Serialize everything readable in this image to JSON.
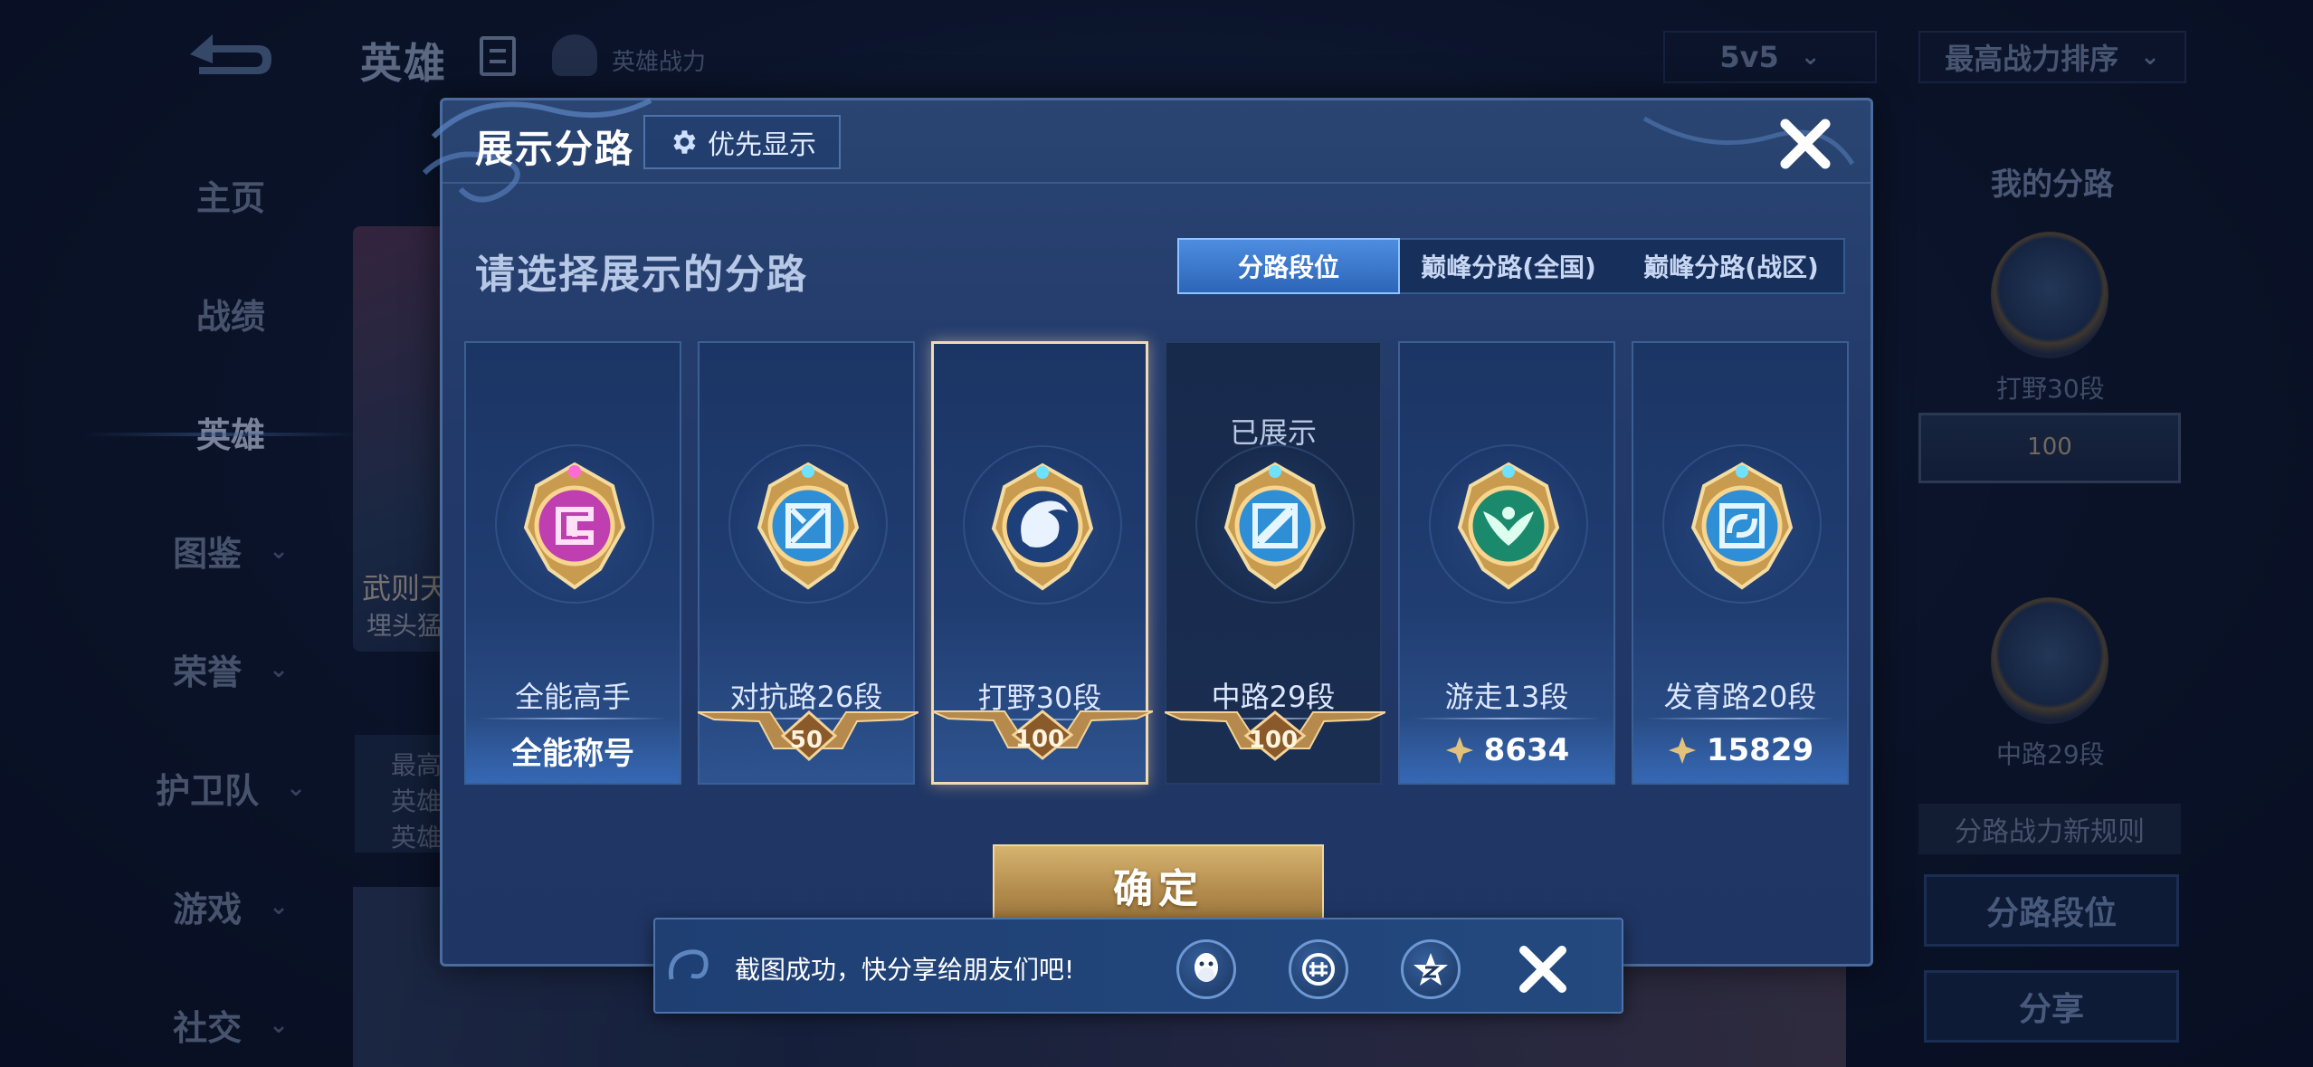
{
  "background": {
    "top_title": "英雄",
    "top_sub": "英雄战力",
    "mode_dropdown": "5v5",
    "sort_dropdown": "最高战力排序",
    "nav": [
      {
        "label": "主页",
        "has_chevron": false
      },
      {
        "label": "战绩",
        "has_chevron": false
      },
      {
        "label": "英雄",
        "has_chevron": false,
        "active": true
      },
      {
        "label": "图鉴",
        "has_chevron": true
      },
      {
        "label": "荣誉",
        "has_chevron": true
      },
      {
        "label": "护卫队",
        "has_chevron": true
      },
      {
        "label": "游戏",
        "has_chevron": true
      },
      {
        "label": "社交",
        "has_chevron": true
      }
    ],
    "hero_name": "武则天",
    "hero_sub": "埋头猛",
    "hero_info": [
      "最高",
      "英雄",
      "英雄"
    ],
    "right_panel": {
      "title": "我的分路",
      "badge1_label": "打野30段",
      "badge1_plate": "100",
      "badge2_label": "中路29段",
      "rule": "分路战力新规则",
      "btn_lane": "分路段位",
      "btn_share": "分享"
    }
  },
  "modal": {
    "title": "展示分路",
    "priority_button": "优先显示",
    "subtitle": "请选择展示的分路",
    "tabs": [
      {
        "label": "分路段位",
        "active": true
      },
      {
        "label": "巅峰分路(全国)",
        "active": false
      },
      {
        "label": "巅峰分路(战区)",
        "active": false
      }
    ],
    "cards": [
      {
        "name": "全能高手",
        "footer_type": "text",
        "footer": "全能称号",
        "emblem": "allround-emblem-icon",
        "accent": "#c03fb0"
      },
      {
        "name": "对抗路26段",
        "footer_type": "plate",
        "footer": "50",
        "emblem": "clash-lane-emblem-icon",
        "accent": "#3aa6e0"
      },
      {
        "name": "打野30段",
        "footer_type": "plate",
        "footer": "100",
        "emblem": "jungle-dragon-emblem-icon",
        "accent": "#3aa6e0",
        "selected": true
      },
      {
        "name": "中路29段",
        "footer_type": "plate",
        "footer": "100",
        "emblem": "mid-lane-emblem-icon",
        "accent": "#3aa6e0",
        "shown_label": "已展示",
        "dimmed": true
      },
      {
        "name": "游走13段",
        "footer_type": "points",
        "footer": "8634",
        "emblem": "roam-wings-emblem-icon",
        "accent": "#1f9a78"
      },
      {
        "name": "发育路20段",
        "footer_type": "points",
        "footer": "15829",
        "emblem": "farm-lane-emblem-icon",
        "accent": "#3aa6e0"
      }
    ],
    "confirm_button": "确定"
  },
  "toast": {
    "text": "截图成功，快分享给朋友们吧!",
    "share_targets": [
      "qq-icon",
      "wechat-moments-icon",
      "qzone-icon"
    ]
  }
}
